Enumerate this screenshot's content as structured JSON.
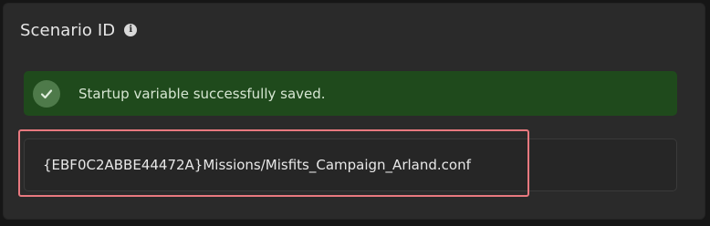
{
  "section": {
    "title": "Scenario ID",
    "info_icon": "info-icon"
  },
  "alert": {
    "icon": "check-circle-icon",
    "message": "Startup variable successfully saved.",
    "color": "#1f4a1c"
  },
  "field": {
    "value": "{EBF0C2ABBE44472A}Missions/Misfits_Campaign_Arland.conf"
  },
  "highlight_color": "#e8797f"
}
